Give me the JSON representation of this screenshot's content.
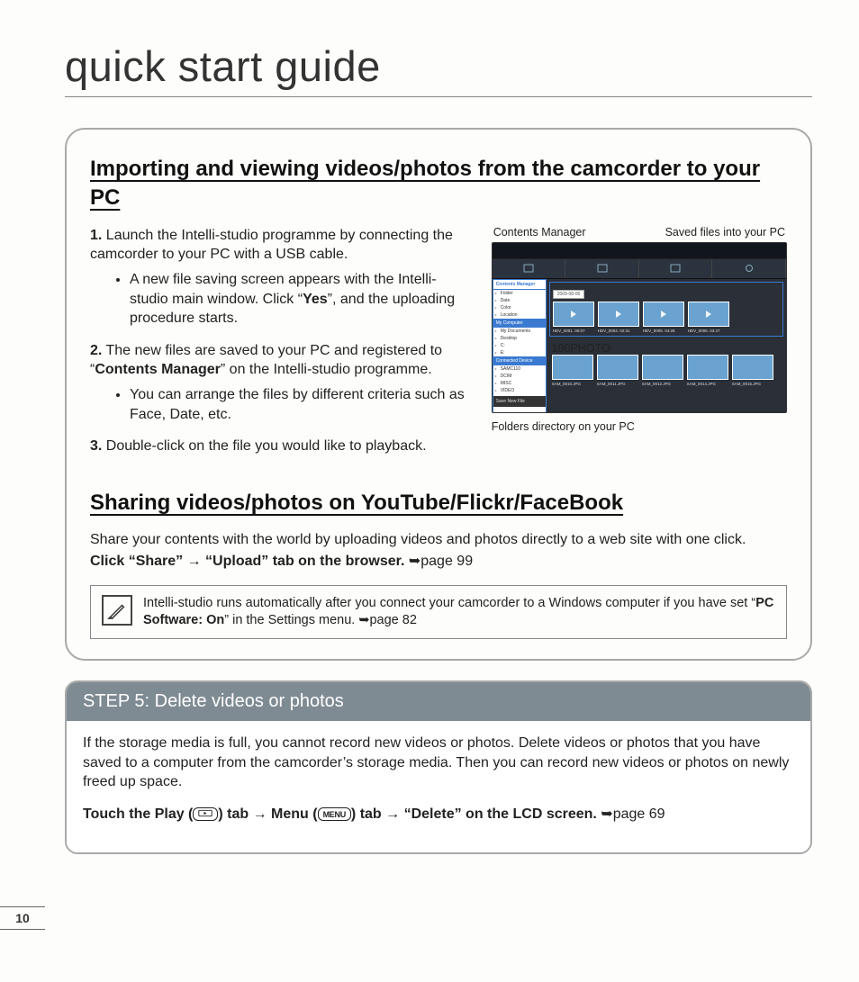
{
  "page_title": "quick start guide",
  "page_number": "10",
  "section1": {
    "heading": "Importing and viewing videos/photos from the camcorder to your PC",
    "steps": [
      {
        "num": "1.",
        "text": "Launch the Intelli-studio programme by connecting the camcorder to your PC with a USB cable.",
        "subs": [
          {
            "pre": "A new file saving screen appears with the Intelli-studio main window. Click “",
            "bold": "Yes",
            "post": "”, and the uploading procedure starts."
          }
        ]
      },
      {
        "num": "2.",
        "text_pre": "The new files are saved to your PC and registered to “",
        "text_bold": "Contents Manager",
        "text_post": "” on the Intelli-studio programme.",
        "subs": [
          {
            "pre": "You can arrange the files by different criteria such as Face, Date, etc.",
            "bold": "",
            "post": ""
          }
        ]
      },
      {
        "num": "3.",
        "text": "Double-click on the file you would like to playback."
      }
    ],
    "fig": {
      "label_left": "Contents Manager",
      "label_right": "Saved files into your PC",
      "caption_bottom": "Folders directory on your PC",
      "sidebar": {
        "hdr1": "Contents Manager",
        "items1": [
          "Folder",
          "Date",
          "Color",
          "Location"
        ],
        "hdr2": "My Computer",
        "items2": [
          "My Documents",
          "Desktop",
          "C:",
          "E:"
        ],
        "hdr3": "Connected Device",
        "items3": [
          "SAMC110",
          "DCIM",
          "MISC",
          "VIDEO"
        ],
        "dark": "Save New File"
      },
      "date_bar": "2009-08-06",
      "folder_bar": "100PHOTO",
      "row1": [
        "HDV_0001.   00:07",
        "HDV_0004.   02:31",
        "HDV_0005.   04:28",
        "HDV_0006.   03:47"
      ],
      "row2": [
        "SAM_0010.JPG",
        "SAM_0011.JPG",
        "SAM_0012.JPG",
        "SAM_0014.JPG",
        "SAM_0015.JPG"
      ]
    }
  },
  "section2": {
    "heading": "Sharing videos/photos on YouTube/Flickr/FaceBook",
    "p1": "Share your contents with the world by uploading videos and photos directly to a web site with one click.",
    "p2_bold": "Click “Share” → “Upload” tab on the browser. ",
    "p2_ref": "➥page 99",
    "note_pre": "Intelli-studio runs automatically after you connect your camcorder to a Windows computer if you have set “",
    "note_bold": "PC Software: On",
    "note_post": "” in the Settings menu. ",
    "note_ref": "➥page 82"
  },
  "step5": {
    "heading": "STEP 5: Delete videos or photos",
    "p1": "If the storage media is full, you cannot record new videos or photos. Delete videos or photos that you have saved to a computer from the camcorder’s storage media. Then you can record new videos or photos on newly freed up space.",
    "p2_a": "Touch the Play (",
    "p2_b": ") tab → Menu (",
    "menu_label": "MENU",
    "p2_c": ") tab → “Delete” on the LCD screen. ",
    "p2_ref": "➥page 69"
  }
}
